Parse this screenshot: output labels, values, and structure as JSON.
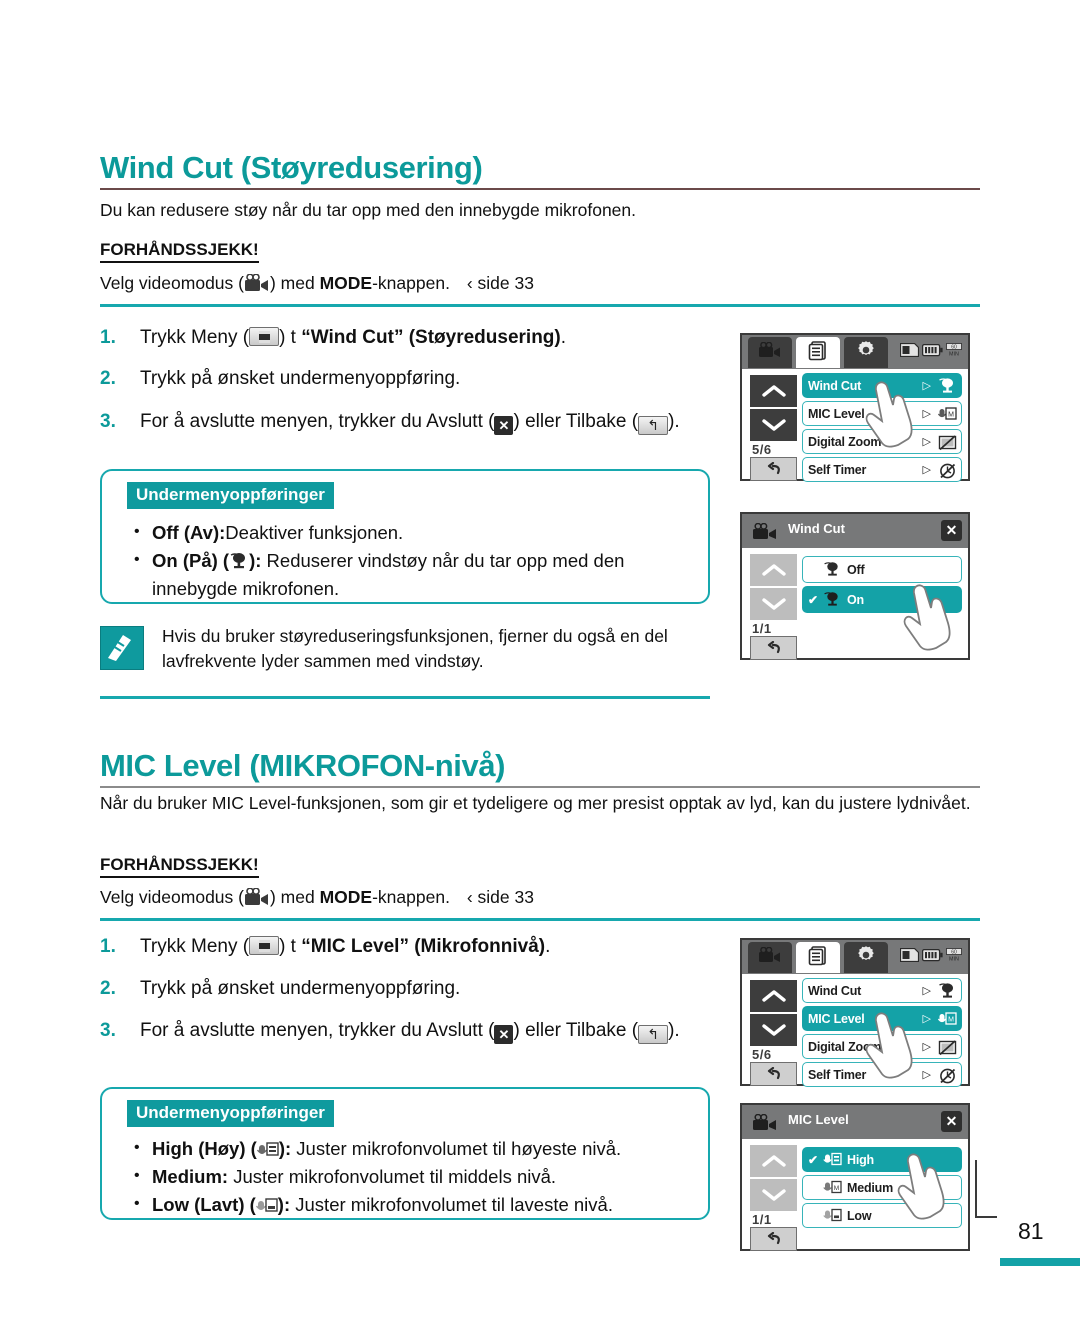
{
  "page": {
    "number": "81"
  },
  "sections": [
    {
      "id": "wind-cut",
      "heading": "Wind Cut (Støyreduser ing)",
      "heading_text": "Wind Cut (Støyredusering)",
      "intro": "Du kan redusere støy når du tar opp med den innebygde mikrofonen.",
      "precheck_label": "FORHÅNDSSJEKK!",
      "precheck_text_before": "Velg videomodus (",
      "precheck_text_mid": ") med ",
      "precheck_bold": "MODE",
      "precheck_text_after": "-knappen.",
      "precheck_page_ref": "‹ side 33",
      "steps": [
        {
          "num": "1.",
          "pre": "Trykk Meny (",
          "mid": ") t ",
          "bold": "“Wind Cut” (Støyredusering)",
          "post": "."
        },
        {
          "num": "2.",
          "full": "Trykk på ønsket undermenyoppføring."
        },
        {
          "num": "3.",
          "pre": "For å avslutte menyen, trykker du Avslutt (",
          "mid": ") eller Tilbake (",
          "post": ")."
        }
      ],
      "submenu": {
        "tag": "Undermenyoppføringer",
        "items": [
          {
            "bold": "Off (Av):",
            "text": "Deaktiver funksjonen.",
            "icon": ""
          },
          {
            "bold": "On (På) (",
            "icon": "wind-cut-icon",
            "bold_tail": "):",
            "text": " Reduserer vindstøy når du tar opp med den innebygde mikrofonen."
          }
        ]
      },
      "note": "Hvis du bruker støyreduseringsfunksjonen, fjerner du også en del lavfrekvente lyder sammen med vindstøy."
    },
    {
      "id": "mic-level",
      "heading_text": "MIC Level (MIKROFON-nivå)",
      "intro": "Når du bruker MIC Level-funksjonen, som gir et tydeligere og mer presist opptak av lyd, kan du justere lydnivået.",
      "precheck_label": "FORHÅNDSSJEKK!",
      "precheck_text_before": "Velg videomodus (",
      "precheck_text_mid": ") med ",
      "precheck_bold": "MODE",
      "precheck_text_after": "-knappen.",
      "precheck_page_ref": "‹ side 33",
      "steps": [
        {
          "num": "1.",
          "pre": "Trykk Meny (",
          "mid": ") t ",
          "bold": "“MIC Level” (Mikrofonnivå)",
          "post": "."
        },
        {
          "num": "2.",
          "full": "Trykk på ønsket undermenyoppføring."
        },
        {
          "num": "3.",
          "pre": "For å avslutte menyen, trykker du Avslutt (",
          "mid": ") eller Tilbake (",
          "post": ")."
        }
      ],
      "submenu": {
        "tag": "Undermenyoppføringer",
        "items": [
          {
            "bold": "High (Høy) (",
            "bold_tail": "):",
            "text": " Juster mikrofonvolumet til høyeste nivå."
          },
          {
            "bold": "Medium:",
            "text": " Juster mikrofonvolumet til middels nivå."
          },
          {
            "bold": "Low (Lavt) (",
            "bold_tail": "):",
            "text": " Juster mikrofonvolumet til laveste nivå."
          }
        ]
      }
    }
  ],
  "lcd_screens": [
    {
      "id": "wind-cut-menu",
      "type": "menu",
      "tabs": [
        "camcorder-icon",
        "menu-pages-icon",
        "gear-icon"
      ],
      "active_tab_index": 1,
      "status_icons": [
        "memory-card-icon",
        "battery-icon",
        "minutes-icon"
      ],
      "page_indicator": "5/6",
      "items": [
        {
          "label": "Wind Cut",
          "selected": true,
          "arrow": "▷",
          "icon": "wind-cut-icon"
        },
        {
          "label": "MIC Level",
          "selected": false,
          "arrow": "▷",
          "icon": "mic-level-icon"
        },
        {
          "label": "Digital Zoom",
          "selected": false,
          "arrow": "▷",
          "icon": "digital-zoom-off-icon"
        },
        {
          "label": "Self Timer",
          "selected": false,
          "arrow": "▷",
          "icon": "self-timer-off-icon"
        }
      ]
    },
    {
      "id": "wind-cut-submenu",
      "type": "submenu",
      "title": "Wind Cut",
      "close_label": "✕",
      "page_indicator": "1/1",
      "items": [
        {
          "label": "Off",
          "selected": false,
          "checked": false,
          "icon": "wind-cut-off-icon"
        },
        {
          "label": "On",
          "selected": true,
          "checked": true,
          "icon": "wind-cut-on-icon"
        }
      ]
    },
    {
      "id": "mic-level-menu",
      "type": "menu",
      "tabs": [
        "camcorder-icon",
        "menu-pages-icon",
        "gear-icon"
      ],
      "active_tab_index": 1,
      "status_icons": [
        "memory-card-icon",
        "battery-icon",
        "minutes-icon"
      ],
      "page_indicator": "5/6",
      "items": [
        {
          "label": "Wind Cut",
          "selected": false,
          "arrow": "▷",
          "icon": "wind-cut-icon"
        },
        {
          "label": "MIC Level",
          "selected": true,
          "arrow": "▷",
          "icon": "mic-level-icon"
        },
        {
          "label": "Digital Zoom",
          "selected": false,
          "arrow": "▷",
          "icon": "digital-zoom-off-icon"
        },
        {
          "label": "Self Timer",
          "selected": false,
          "arrow": "▷",
          "icon": "self-timer-off-icon"
        }
      ]
    },
    {
      "id": "mic-level-submenu",
      "type": "submenu",
      "title": "MIC Level",
      "close_label": "✕",
      "page_indicator": "1/1",
      "items": [
        {
          "label": "High",
          "selected": true,
          "checked": true,
          "icon": "mic-high-icon"
        },
        {
          "label": "Medium",
          "selected": false,
          "checked": false,
          "icon": "mic-medium-icon"
        },
        {
          "label": "Low",
          "selected": false,
          "checked": false,
          "icon": "mic-low-icon"
        }
      ]
    }
  ],
  "colors": {
    "teal": "#14a2a7",
    "heading_teal": "#0c9a9a",
    "heading_rule": "#6b4a4a",
    "lcd_header_grey": "#777879",
    "lcd_dark": "#3d3d3d"
  }
}
